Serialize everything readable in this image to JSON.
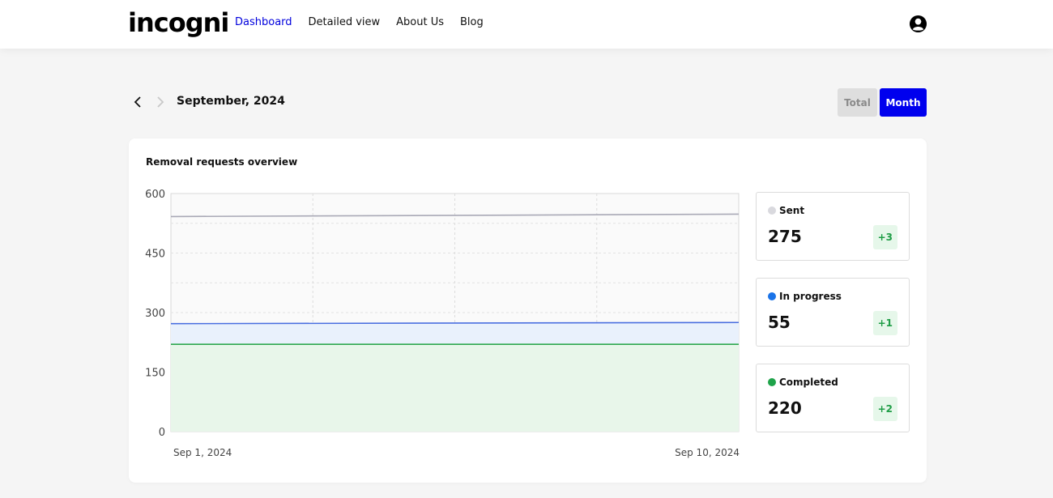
{
  "brand": {
    "logo_text": "incogni"
  },
  "nav": {
    "items": [
      {
        "label": "Dashboard",
        "active": true
      },
      {
        "label": "Detailed view",
        "active": false
      },
      {
        "label": "About Us",
        "active": false
      },
      {
        "label": "Blog",
        "active": false
      }
    ]
  },
  "account": {
    "icon": "account-circle-icon"
  },
  "period": {
    "label": "September, 2024",
    "prev_icon": "chevron-left-icon",
    "next_icon": "chevron-right-icon",
    "toggle": {
      "total_label": "Total",
      "month_label": "Month",
      "selected": "Month"
    }
  },
  "overview": {
    "title": "Removal requests overview",
    "stats": [
      {
        "label": "Sent",
        "value": "275",
        "delta": "+3",
        "color": "#d9d9de"
      },
      {
        "label": "In progress",
        "value": "55",
        "delta": "+1",
        "color": "#1a73e8"
      },
      {
        "label": "Completed",
        "value": "220",
        "delta": "+2",
        "color": "#1fa34a"
      }
    ]
  },
  "colors": {
    "accent": "#0000ee",
    "sent": "#a9a9b6",
    "in_progress": "#4a6fe0",
    "completed": "#2fa84f"
  },
  "chart_data": {
    "type": "area",
    "x": [
      "Sep 1, 2024",
      "Sep 10, 2024"
    ],
    "x_tick_labels": [
      "Sep 1, 2024",
      "Sep 10, 2024"
    ],
    "ylim": [
      0,
      600
    ],
    "y_ticks": [
      0,
      150,
      300,
      450,
      600
    ],
    "series": [
      {
        "name": "Sent",
        "values": [
          542,
          548
        ]
      },
      {
        "name": "In progress",
        "values": [
          272,
          275
        ]
      },
      {
        "name": "Completed",
        "values": [
          220,
          220
        ]
      }
    ],
    "grid": true
  }
}
